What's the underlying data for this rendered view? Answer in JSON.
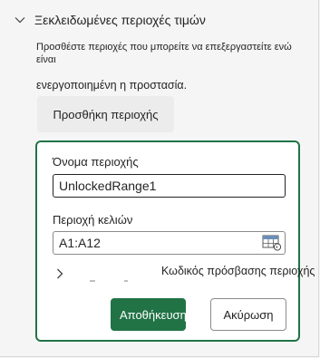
{
  "section": {
    "title": "Ξεκλειδωμένες περιοχές τιμών",
    "icon": "chevron-down-icon"
  },
  "description": {
    "line1": "Προσθέστε περιοχές που μπορείτε να επεξεργαστείτε ενώ είναι",
    "line2": "ενεργοποιημένη η προστασία."
  },
  "add_range_button": "Προσθήκη περιοχής",
  "form": {
    "range_name_label": "Όνομα περιοχής",
    "range_name_value": "UnlockedRange1",
    "cell_range_label": "Περιοχή κελιών",
    "cell_range_value": "A1:A12",
    "password_label": "Κωδικός πρόσβασης περιοχής",
    "save_label": "Αποθήκευση",
    "cancel_label": "Ακύρωση"
  },
  "colors": {
    "accent": "#217346",
    "panel_bg": "#f5f5f5",
    "text": "#242424"
  }
}
